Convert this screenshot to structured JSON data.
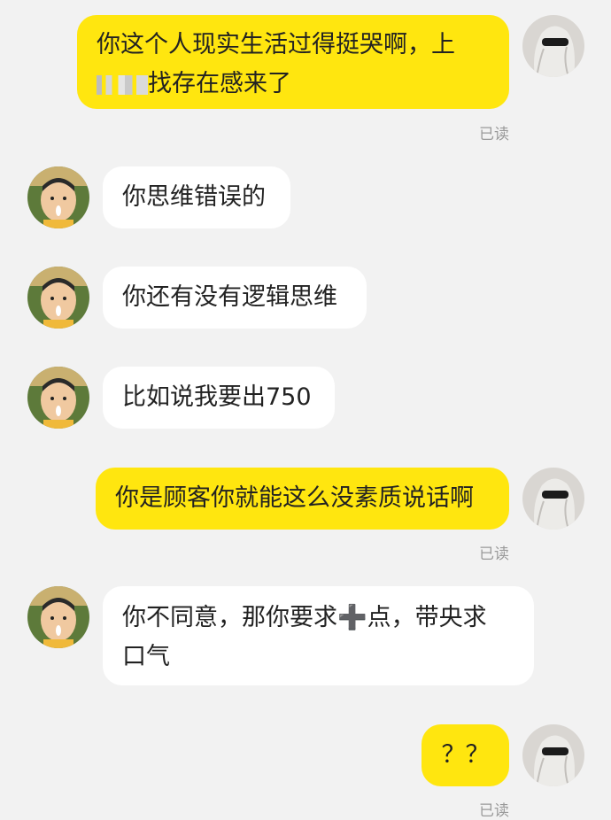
{
  "messages": [
    {
      "side": "self",
      "text_line1": "你这个人现实生活过得挺哭啊，上",
      "text_line2_prefix": "",
      "text_line2": "找存在感来了",
      "read": "已读"
    },
    {
      "side": "other",
      "text": "你思维错误的"
    },
    {
      "side": "other",
      "text": "你还有没有逻辑思维"
    },
    {
      "side": "other",
      "text": "比如说我要出750"
    },
    {
      "side": "self",
      "text": "你是顾客你就能这么没素质说话啊",
      "read": "已读"
    },
    {
      "side": "other",
      "text_line1": "你不同意，那你要求➕点，带央求",
      "text_line2": "口气"
    },
    {
      "side": "self",
      "text": "？？",
      "read": "已读"
    }
  ],
  "colors": {
    "self_bubble": "#ffe60f",
    "other_bubble": "#ffffff",
    "background": "#f2f2f2",
    "read_text": "#9a9a9a"
  }
}
